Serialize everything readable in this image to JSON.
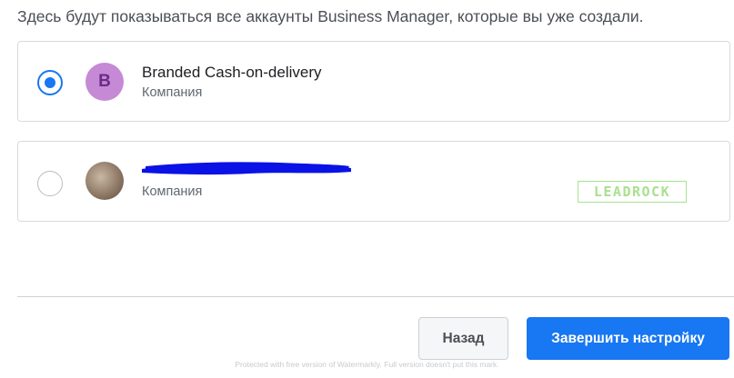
{
  "intro_text": "Здесь будут показываться все аккаунты Business Manager, которые вы уже создали.",
  "accounts": [
    {
      "name": "Branded Cash-on-delivery",
      "type": "Компания",
      "avatar_letter": "B",
      "selected": true
    },
    {
      "name": "",
      "type": "Компания",
      "selected": false,
      "name_redacted": true
    }
  ],
  "watermark_logo": "LEADROCK",
  "buttons": {
    "back_label": "Назад",
    "finish_label": "Завершить настройку"
  },
  "footer_watermark": "Protected with free version of Watermarkly. Full version doesn't put this mark.",
  "colors": {
    "accent": "#1877f2",
    "avatar_b": "#c589d6",
    "redaction": "#0a12e6",
    "logo": "#a9e08f"
  }
}
